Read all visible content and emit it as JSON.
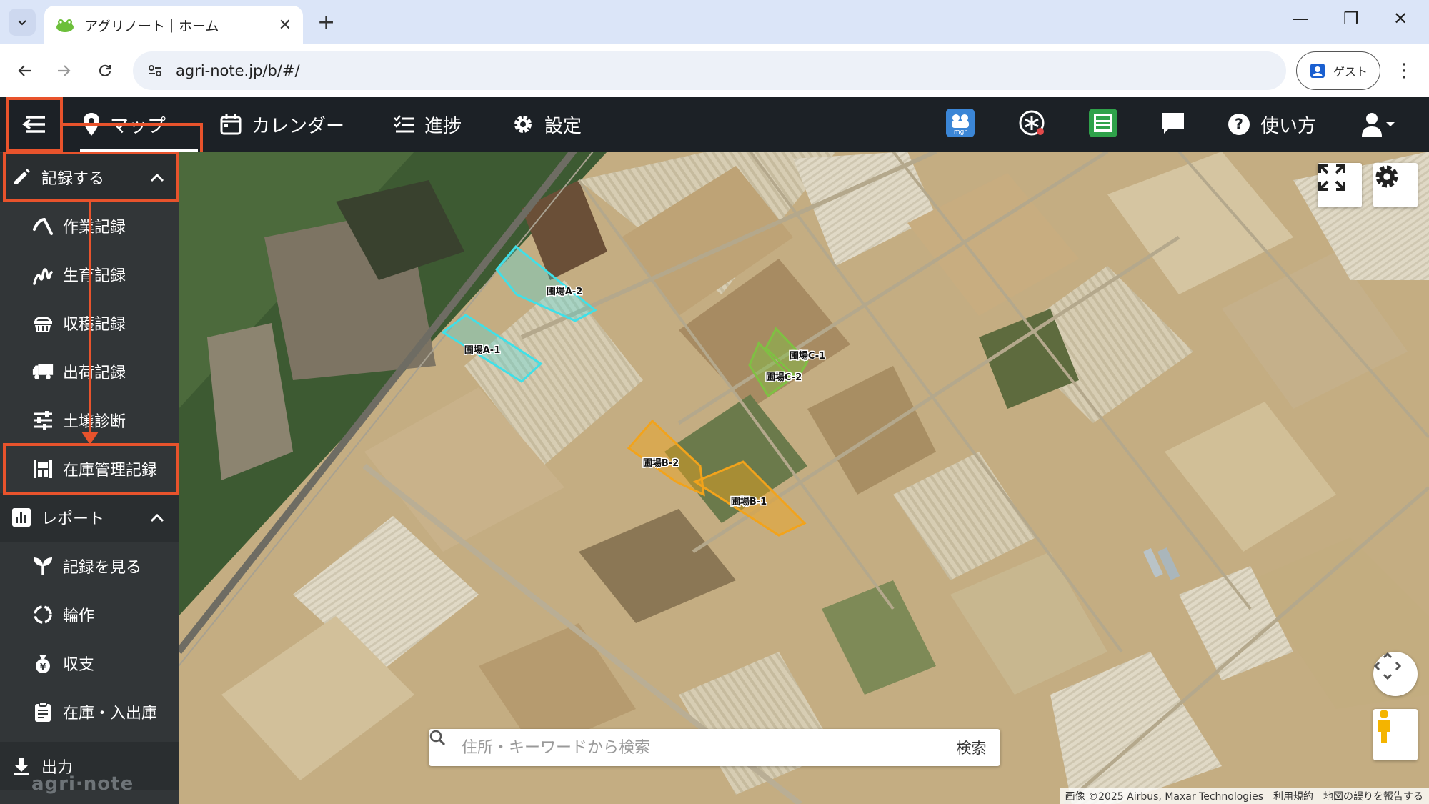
{
  "browser": {
    "tab_title": "アグリノート｜ホーム",
    "url": "agri-note.jp/b/#/",
    "guest_label": "ゲスト"
  },
  "header": {
    "nav": [
      {
        "label": "マップ",
        "icon": "map-pin-icon"
      },
      {
        "label": "カレンダー",
        "icon": "calendar-icon"
      },
      {
        "label": "進捗",
        "icon": "progress-list-icon"
      },
      {
        "label": "設定",
        "icon": "gear-icon"
      }
    ],
    "help_label": "使い方"
  },
  "sidebar": {
    "record_section": {
      "label": "記録する",
      "icon": "pencil-icon"
    },
    "record_items": [
      {
        "label": "作業記録",
        "icon": "hoe-icon"
      },
      {
        "label": "生育記録",
        "icon": "sprout-icon"
      },
      {
        "label": "収穫記録",
        "icon": "basket-icon"
      },
      {
        "label": "出荷記録",
        "icon": "truck-icon"
      },
      {
        "label": "土壌診断",
        "icon": "sliders-icon"
      },
      {
        "label": "在庫管理記録",
        "icon": "inventory-icon"
      }
    ],
    "report_section": {
      "label": "レポート",
      "icon": "bar-chart-icon"
    },
    "report_items": [
      {
        "label": "記録を見る",
        "icon": "seedling-icon"
      },
      {
        "label": "輪作",
        "icon": "rotation-icon"
      },
      {
        "label": "収支",
        "icon": "money-bag-icon"
      },
      {
        "label": "在庫・入出庫",
        "icon": "clipboard-icon"
      }
    ],
    "export_label": "出力",
    "logo": "agri·note"
  },
  "map": {
    "fields": [
      {
        "label": "圃場A-2",
        "color": "#3fe0e8"
      },
      {
        "label": "圃場A-1",
        "color": "#3fe0e8"
      },
      {
        "label": "圃場C-1",
        "color": "#7fc043"
      },
      {
        "label": "圃場C-2",
        "color": "#7fc043"
      },
      {
        "label": "圃場B-2",
        "color": "#f2a31b"
      },
      {
        "label": "圃場B-1",
        "color": "#f2a31b"
      }
    ],
    "search_placeholder": "住所・キーワードから検索",
    "search_button": "検索",
    "credit_imagery": "画像 ©2025 Airbus, Maxar Technologies",
    "credit_terms": "利用規約",
    "credit_report": "地図の誤りを報告する"
  },
  "colors": {
    "accent": "#e8532c",
    "header_bg": "#1c2126",
    "sidebar_bg": "#323638"
  }
}
